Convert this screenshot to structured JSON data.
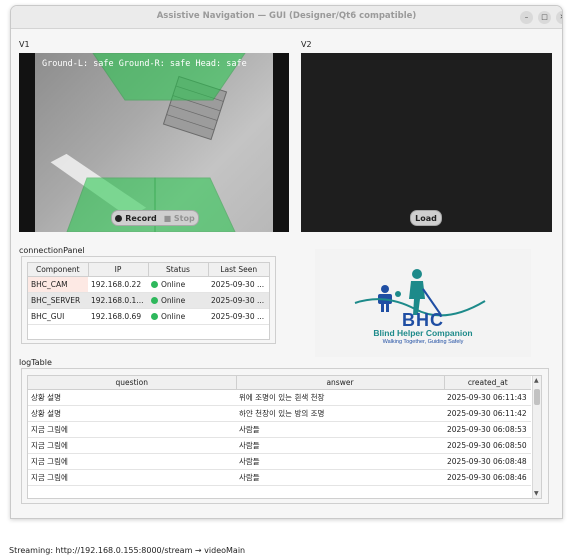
{
  "window": {
    "title": "Assistive Navigation — GUI (Designer/Qt6 compatible)"
  },
  "v1": {
    "label": "V1",
    "overlay": "Ground-L: safe   Ground-R: safe   Head: safe",
    "record_label": "Record",
    "stop_label": "Stop"
  },
  "v2": {
    "label": "V2",
    "load_label": "Load"
  },
  "connection": {
    "label": "connectionPanel",
    "headers": [
      "Component",
      "IP",
      "Status",
      "Last Seen"
    ],
    "rows": [
      {
        "component": "BHC_CAM",
        "ip": "192.168.0.22",
        "status": "Online",
        "last_seen": "2025-09-30 ..."
      },
      {
        "component": "BHC_SERVER",
        "ip": "192.168.0.1...",
        "status": "Online",
        "last_seen": "2025-09-30 ..."
      },
      {
        "component": "BHC_GUI",
        "ip": "192.168.0.69",
        "status": "Online",
        "last_seen": "2025-09-30 ..."
      }
    ]
  },
  "logo": {
    "name": "BHC",
    "subtitle": "Blind Helper Companion",
    "tagline": "Walking Together, Guiding Safely"
  },
  "log": {
    "label": "logTable",
    "headers": [
      "question",
      "answer",
      "created_at"
    ],
    "rows": [
      {
        "question": "상황 설명",
        "answer": "위에 조명이 있는 흰색 천장",
        "created_at": "2025-09-30 06:11:43"
      },
      {
        "question": "상황 설명",
        "answer": "하얀 천장이 있는 방의 조명",
        "created_at": "2025-09-30 06:11:42"
      },
      {
        "question": "지금 그림에",
        "answer": "사람들",
        "created_at": "2025-09-30 06:08:53"
      },
      {
        "question": "지금 그림에",
        "answer": "사람들",
        "created_at": "2025-09-30 06:08:50"
      },
      {
        "question": "지금 그림에",
        "answer": "사람들",
        "created_at": "2025-09-30 06:08:48"
      },
      {
        "question": "지금 그림에",
        "answer": "사람들",
        "created_at": "2025-09-30 06:08:46"
      }
    ]
  },
  "status_bar": "Streaming: http://192.168.0.155:8000/stream → videoMain",
  "colors": {
    "online": "#2eb85c",
    "zone": "#22c84a",
    "logo_teal": "#1d8a8a",
    "logo_blue": "#1f4ea3"
  }
}
